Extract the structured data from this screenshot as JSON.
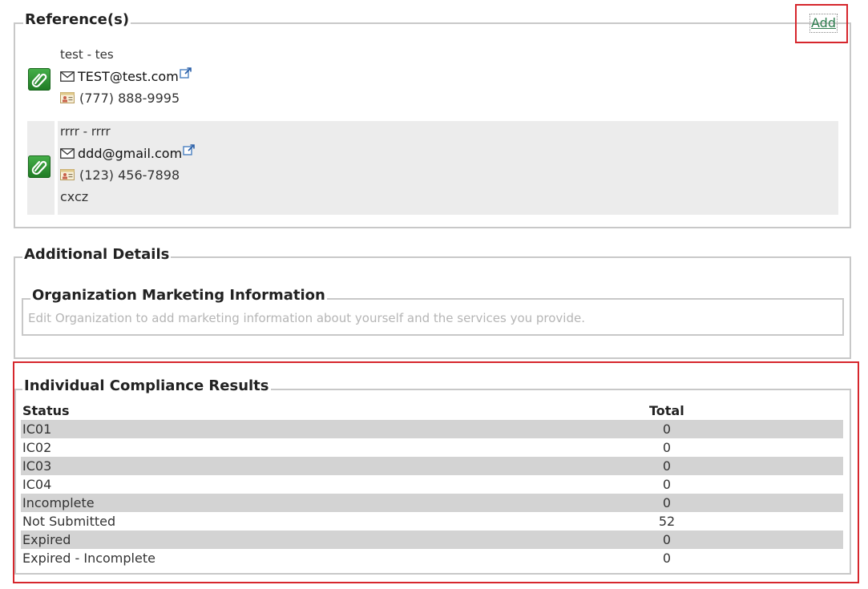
{
  "references": {
    "legend": "Reference(s)",
    "add_label": "Add",
    "items": [
      {
        "name": "test - tes",
        "email": "TEST@test.com",
        "phone": "(777) 888-9995",
        "note": ""
      },
      {
        "name": "rrrr - rrrr",
        "email": "ddd@gmail.com",
        "phone": "(123) 456-7898",
        "note": "cxcz"
      }
    ]
  },
  "additional_details": {
    "legend": "Additional Details",
    "org_marketing": {
      "legend": "Organization Marketing Information",
      "text": "Edit Organization to add marketing information about yourself and the services you provide."
    }
  },
  "compliance": {
    "legend": "Individual Compliance Results",
    "headers": {
      "status": "Status",
      "total": "Total"
    },
    "rows": [
      {
        "status": "IC01",
        "total": "0"
      },
      {
        "status": "IC02",
        "total": "0"
      },
      {
        "status": "IC03",
        "total": "0"
      },
      {
        "status": "IC04",
        "total": "0"
      },
      {
        "status": "Incomplete",
        "total": "0"
      },
      {
        "status": "Not Submitted",
        "total": "52"
      },
      {
        "status": "Expired",
        "total": "0"
      },
      {
        "status": "Expired - Incomplete",
        "total": "0"
      }
    ]
  },
  "colors": {
    "highlight": "#d6262c",
    "link": "#2e7d4f",
    "row_shade": "#d3d3d3",
    "icon_green": "#2e8b32"
  },
  "icons": [
    "paperclip-icon",
    "envelope-icon",
    "contact-card-icon",
    "external-link-icon"
  ]
}
